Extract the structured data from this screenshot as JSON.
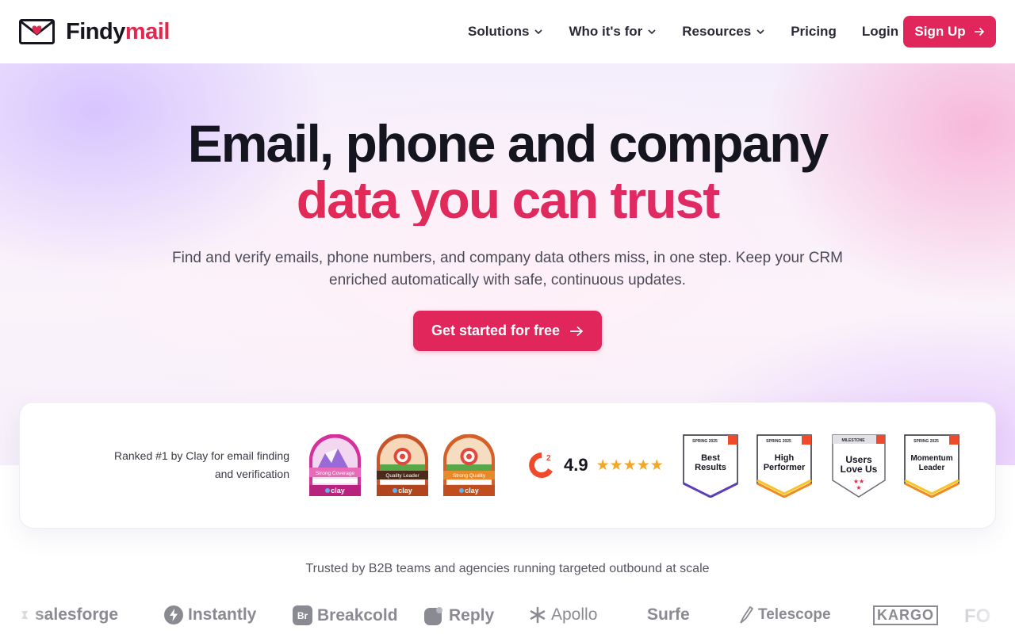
{
  "nav": {
    "logo": {
      "word_dark": "Findy",
      "word_accent": "mail",
      "icon": "envelope-heart-icon"
    },
    "items": [
      {
        "label": "Solutions",
        "dropdown": true
      },
      {
        "label": "Who it's for",
        "dropdown": true
      },
      {
        "label": "Resources",
        "dropdown": true
      },
      {
        "label": "Pricing",
        "dropdown": false
      },
      {
        "label": "Login",
        "dropdown": false
      }
    ],
    "signup_label": "Sign Up"
  },
  "hero": {
    "title_line1": "Email, phone and company",
    "title_line2": "data you can trust",
    "subtitle": "Find and verify emails, phone numbers, and company data others miss, in one step. Keep your CRM enriched automatically with safe, continuous updates.",
    "cta_label": "Get started for free"
  },
  "awards": {
    "rank_text": "Ranked #1 by Clay for email finding and verification",
    "clay_badges": [
      {
        "ribbon": "Strong Coverage",
        "brand": "clay",
        "color": "#d6309a"
      },
      {
        "ribbon": "Quality Leader",
        "brand": "clay",
        "color": "#c8552a"
      },
      {
        "ribbon": "Strong Quality",
        "brand": "clay",
        "color": "#d4602a"
      }
    ],
    "g2": {
      "logo": "G2",
      "rating": "4.9",
      "stars": "★★★★★"
    },
    "g2_badges": [
      {
        "season": "SPRING 2025",
        "line1": "Best",
        "line2": "Results",
        "accent": "#5b3fb8"
      },
      {
        "season": "SPRING 2025",
        "line1": "High",
        "line2": "Performer",
        "accent": "#f08a1c"
      },
      {
        "season": "MILESTONE",
        "line1": "Users",
        "line2": "Love Us",
        "accent": "#e2284f"
      },
      {
        "season": "SPRING 2025",
        "line1": "Momentum",
        "line2": "Leader",
        "accent": "#f08a1c"
      }
    ]
  },
  "trusted": {
    "text": "Trusted by B2B teams and agencies running targeted outbound at scale",
    "logos": [
      "salesforge",
      "Instantly",
      "Breakcold",
      "Reply",
      "Apollo",
      "Surfe",
      "Telescope",
      "KARGO",
      "FO"
    ]
  },
  "colors": {
    "accent": "#e0265a",
    "text_dark": "#15151f",
    "star": "#f5a623"
  }
}
